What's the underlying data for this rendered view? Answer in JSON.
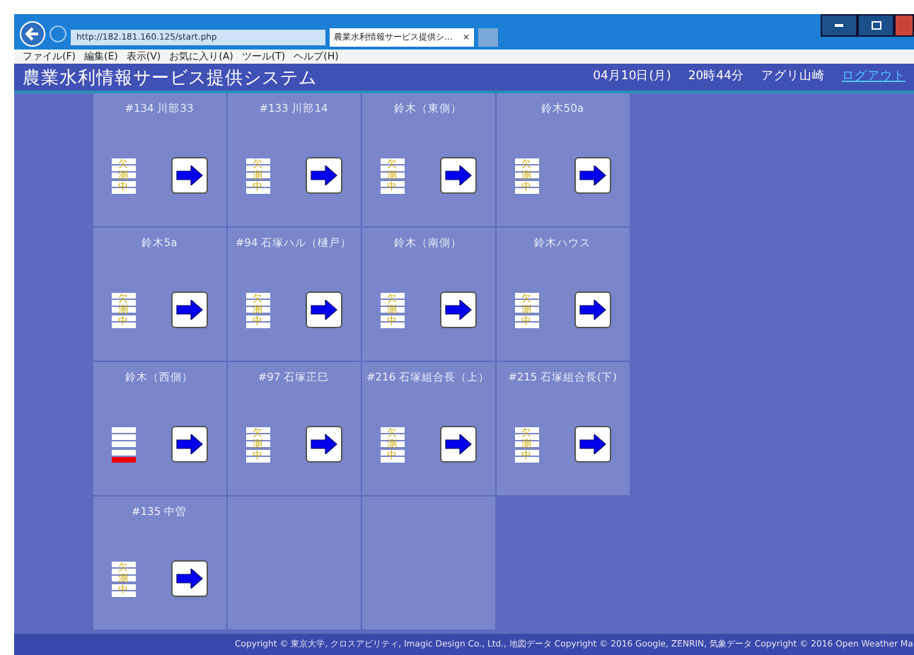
{
  "browser": {
    "address": "http://182.181.160.125/start.php",
    "tab_title": "農業水利情報サービス提供シ...",
    "tab_close": "×",
    "menu": [
      "ファイル(F)",
      "編集(E)",
      "表示(V)",
      "お気に入り(A)",
      "ツール(T)",
      "ヘルプ(H)"
    ]
  },
  "header": {
    "title": "農業水利情報サービス提供システム",
    "date": "04月10日(月)",
    "time": "20時44分",
    "user": "アグリ山崎",
    "logout": "ログアウト"
  },
  "tiles": [
    {
      "kind": "site",
      "title": "#134 川部33",
      "gauge": {
        "kind": "missing",
        "label": "欠測中"
      }
    },
    {
      "kind": "site",
      "title": "#133 川部14",
      "gauge": {
        "kind": "missing",
        "label": "欠測中"
      }
    },
    {
      "kind": "site",
      "title": "鈴木（東側）",
      "gauge": {
        "kind": "missing",
        "label": "欠測中"
      }
    },
    {
      "kind": "site",
      "title": "鈴木50a",
      "gauge": {
        "kind": "missing",
        "label": "欠測中"
      }
    },
    {
      "kind": "site",
      "title": "鈴木5a",
      "gauge": {
        "kind": "missing",
        "label": "欠測中"
      }
    },
    {
      "kind": "site",
      "title": "#94 石塚ハル（樋戸）",
      "gauge": {
        "kind": "missing",
        "label": "欠測中"
      }
    },
    {
      "kind": "site",
      "title": "鈴木（南側）",
      "gauge": {
        "kind": "missing",
        "label": "欠測中"
      }
    },
    {
      "kind": "site",
      "title": "鈴木ハウス",
      "gauge": {
        "kind": "missing",
        "label": "欠測中"
      }
    },
    {
      "kind": "site",
      "title": "鈴木（西側）",
      "gauge": {
        "kind": "level",
        "level": 0.2
      }
    },
    {
      "kind": "site",
      "title": "#97 石塚正巳",
      "gauge": {
        "kind": "missing",
        "label": "欠測中"
      }
    },
    {
      "kind": "site",
      "title": "#216 石塚組合長（上）",
      "gauge": {
        "kind": "missing",
        "label": "欠測中"
      }
    },
    {
      "kind": "site",
      "title": "#215 石塚組合長(下)",
      "gauge": {
        "kind": "missing",
        "label": "欠測中"
      }
    },
    {
      "kind": "site",
      "title": "#135 中曽",
      "gauge": {
        "kind": "missing",
        "label": "欠測中"
      }
    },
    {
      "kind": "empty"
    },
    {
      "kind": "empty"
    }
  ],
  "footer": "Copyright © 東京大学, クロスアビリティ, Imagic Design Co., Ltd., 地図データ Copyright © 2016 Google, ZENRIN, 気象データ Copyright © 2016 Open Weather Ma"
}
